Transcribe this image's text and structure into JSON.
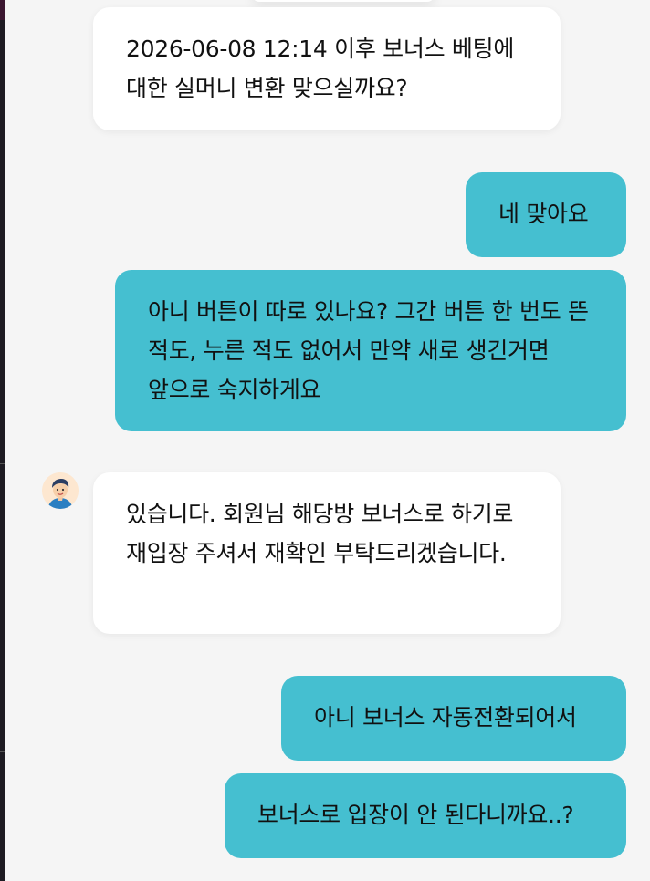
{
  "messages": [
    {
      "sender": "agent",
      "text": "2026-06-08 12:14 이후 보너스 베팅에 대한 실머니 변환 맞으실까요?"
    },
    {
      "sender": "user",
      "text": "네 맞아요"
    },
    {
      "sender": "user",
      "text": "아니 버튼이 따로 있나요? 그간 버튼 한 번도 뜬 적도, 누른 적도 없어서 만약 새로 생긴거면 앞으로 숙지하게요"
    },
    {
      "sender": "agent",
      "text": "있습니다. 회원님 해당방 보너스로 하기로 재입장 주셔서 재확인 부탁드리겠습니다."
    },
    {
      "sender": "user",
      "text": "아니 보너스 자동전환되어서"
    },
    {
      "sender": "user",
      "text": "보너스로 입장이 안 된다니까요..?"
    }
  ],
  "colors": {
    "background": "#f5f5f5",
    "agent_bubble": "#ffffff",
    "user_bubble": "#45bfd0",
    "text": "#111111"
  },
  "icons": {
    "agent_avatar": "agent-avatar-icon"
  }
}
